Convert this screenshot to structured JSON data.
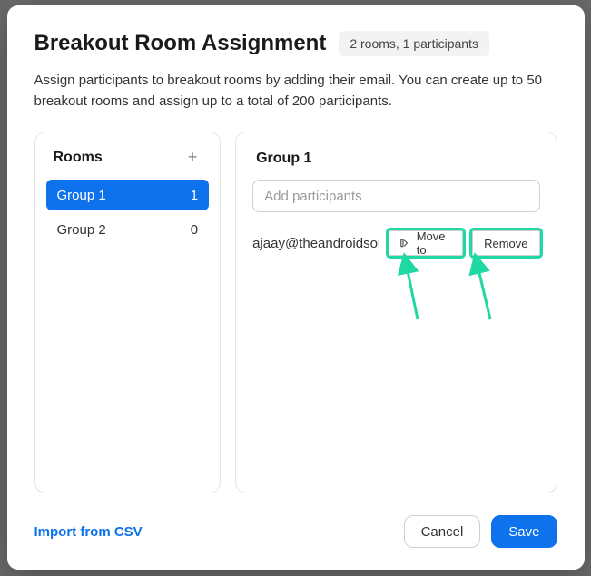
{
  "header": {
    "title": "Breakout Room Assignment",
    "summary": "2 rooms, 1 participants"
  },
  "description": "Assign participants to breakout rooms by adding their email. You can create up to 50 breakout rooms and assign up to a total of 200 participants.",
  "left_panel": {
    "heading": "Rooms",
    "add_icon": "+",
    "rooms": [
      {
        "name": "Group 1",
        "count": "1",
        "active": true
      },
      {
        "name": "Group 2",
        "count": "0",
        "active": false
      }
    ]
  },
  "right_panel": {
    "heading": "Group 1",
    "input_placeholder": "Add participants",
    "participants": [
      {
        "email": "ajaay@theandroidsou",
        "move_to_label": "Move to",
        "remove_label": "Remove"
      }
    ]
  },
  "footer": {
    "import_label": "Import from CSV",
    "cancel_label": "Cancel",
    "save_label": "Save"
  },
  "colors": {
    "primary": "#0e72ed",
    "highlight": "#1fd8a4"
  }
}
